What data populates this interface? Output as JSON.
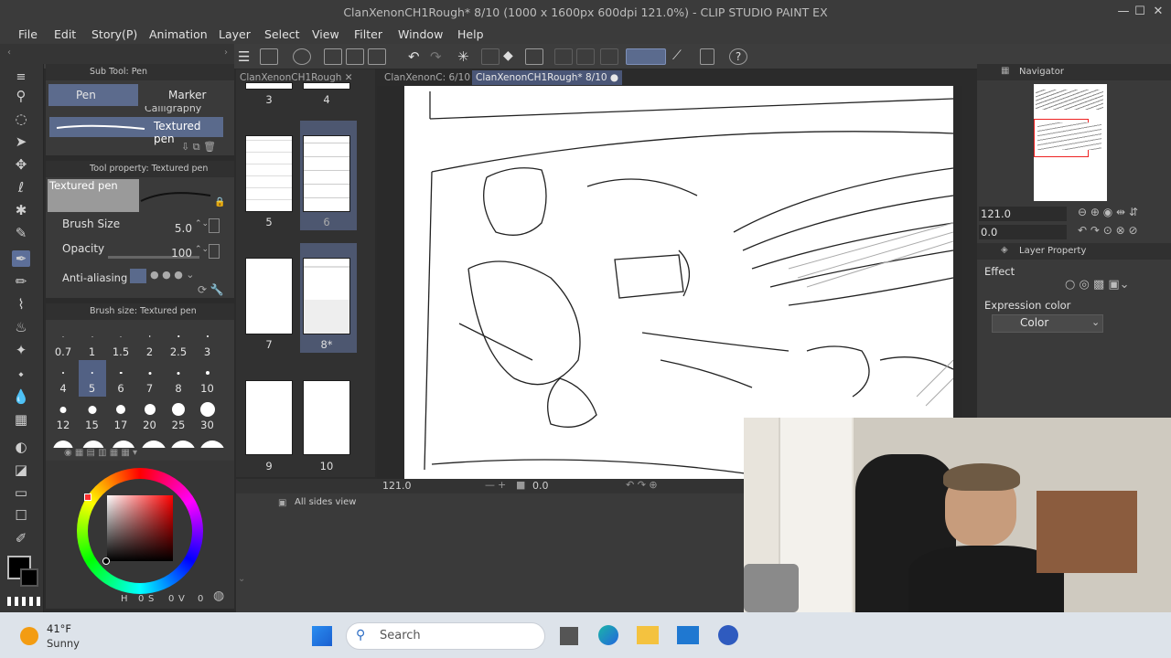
{
  "window": {
    "title": "ClanXenonCH1Rough* 8/10 (1000 x 1600px 600dpi 121.0%)  - CLIP STUDIO PAINT EX",
    "controls": [
      "—",
      "☐",
      "✕"
    ]
  },
  "menu": [
    "File",
    "Edit",
    "Story(P)",
    "Animation",
    "Layer",
    "Select",
    "View",
    "Filter",
    "Window",
    "Help"
  ],
  "doc_tabs": [
    {
      "label": "ClanXenonCH1Rough",
      "close": "✕"
    },
    {
      "label": "ClanXenonC: 6/10",
      "close": "✕"
    },
    {
      "label": "ClanXenonCH1Rough* 8/10",
      "close": "●"
    }
  ],
  "subtool": {
    "header": "Sub Tool: Pen",
    "tabs": [
      "Pen",
      "Marker"
    ],
    "brush_partial": "Calligraphy",
    "brush_selected": "Textured pen"
  },
  "tool_property": {
    "header": "Tool property: Textured pen",
    "preview_label": "Textured pen",
    "brush_size_label": "Brush Size",
    "brush_size_value": "5.0",
    "opacity_label": "Opacity",
    "opacity_value": "100",
    "antialias_label": "Anti-aliasing"
  },
  "brush_size_panel": {
    "header": "Brush size: Textured pen",
    "sizes": [
      "0.7",
      "1",
      "1.5",
      "2",
      "2.5",
      "3",
      "4",
      "5",
      "6",
      "7",
      "8",
      "10",
      "12",
      "15",
      "17",
      "20",
      "25",
      "30"
    ],
    "selected": "5"
  },
  "color_panel": {
    "main_color": "#000000",
    "sub_color": "#000000",
    "readout": [
      "H",
      "0",
      "S",
      "0",
      "V",
      "0"
    ]
  },
  "pages": [
    {
      "label": "3"
    },
    {
      "label": "4"
    },
    {
      "label": "5"
    },
    {
      "label": "6"
    },
    {
      "label": "7"
    },
    {
      "label": "8*"
    },
    {
      "label": "9"
    },
    {
      "label": "10"
    }
  ],
  "status": {
    "zoom": "121.0",
    "angle": "0.0",
    "symbols": [
      "—",
      "+",
      "■"
    ]
  },
  "bottom_panel": {
    "label": "All sides view"
  },
  "navigator": {
    "title": "Navigator",
    "zoom": "121.0",
    "rotation": "0.0"
  },
  "layer_property": {
    "title": "Layer Property",
    "effect_label": "Effect",
    "expression_label": "Expression color",
    "expression_value": "Color"
  },
  "taskbar": {
    "temperature": "41°F",
    "weather": "Sunny",
    "search_placeholder": "Search"
  },
  "colors": {
    "accent": "#5c6b8d",
    "panel": "#3a3a3a",
    "titlebar": "#3b3b3b"
  }
}
